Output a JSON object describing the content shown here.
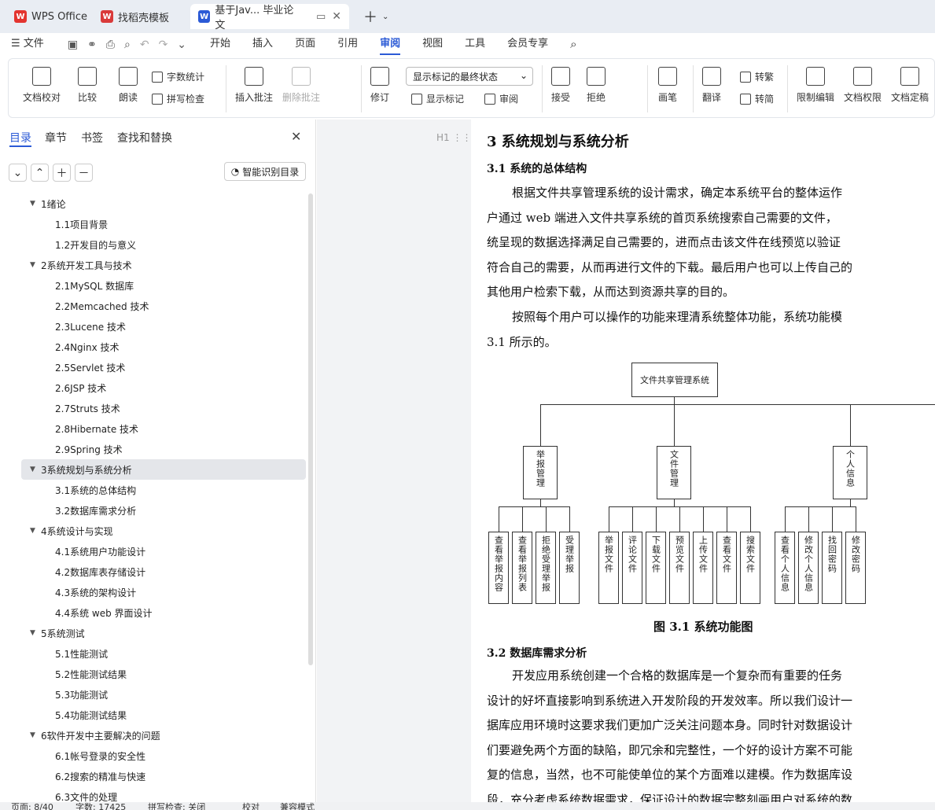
{
  "tabs": [
    {
      "label": "WPS Office"
    },
    {
      "label": "找稻壳模板"
    },
    {
      "label": "基于Jav... 毕业论文"
    }
  ],
  "menu": {
    "file": "文件",
    "items": [
      "开始",
      "插入",
      "页面",
      "引用",
      "审阅",
      "视图",
      "工具",
      "会员专享"
    ]
  },
  "ribbon": {
    "doc_check": "文档校对",
    "compare": "比较",
    "read": "朗读",
    "word_count": "字数统计",
    "spell_check": "拼写检查",
    "insert_comment": "插入批注",
    "delete_comment": "删除批注",
    "revise": "修订",
    "markup_state": "显示标记的最终状态",
    "show_markup": "显示标记",
    "review": "审阅",
    "accept": "接受",
    "reject": "拒绝",
    "pen": "画笔",
    "translate": "翻译",
    "to_traditional": "转繁",
    "to_simplified": "转简",
    "restrict_edit": "限制编辑",
    "doc_permission": "文档权限",
    "doc_finalize": "文档定稿"
  },
  "sidebar": {
    "tabs": [
      "目录",
      "章节",
      "书签",
      "查找和替换"
    ],
    "smart_toc": "智能识别目录",
    "toc": [
      {
        "label": "1绪论",
        "level": 1
      },
      {
        "label": "1.1项目背景",
        "level": 2
      },
      {
        "label": "1.2开发目的与意义",
        "level": 2
      },
      {
        "label": "2系统开发工具与技术",
        "level": 1
      },
      {
        "label": "2.1MySQL 数据库",
        "level": 2
      },
      {
        "label": "2.2Memcached 技术",
        "level": 2
      },
      {
        "label": "2.3Lucene 技术",
        "level": 2
      },
      {
        "label": "2.4Nginx 技术",
        "level": 2
      },
      {
        "label": "2.5Servlet 技术",
        "level": 2
      },
      {
        "label": "2.6JSP 技术",
        "level": 2
      },
      {
        "label": "2.7Struts 技术",
        "level": 2
      },
      {
        "label": "2.8Hibernate 技术",
        "level": 2
      },
      {
        "label": "2.9Spring 技术",
        "level": 2
      },
      {
        "label": "3系统规划与系统分析",
        "level": 1,
        "selected": true
      },
      {
        "label": "3.1系统的总体结构",
        "level": 2
      },
      {
        "label": "3.2数据库需求分析",
        "level": 2
      },
      {
        "label": "4系统设计与实现",
        "level": 1
      },
      {
        "label": "4.1系统用户功能设计",
        "level": 2
      },
      {
        "label": "4.2数据库表存储设计",
        "level": 2
      },
      {
        "label": "4.3系统的架构设计",
        "level": 2
      },
      {
        "label": "4.4系统 web 界面设计",
        "level": 2
      },
      {
        "label": "5系统测试",
        "level": 1
      },
      {
        "label": "5.1性能测试",
        "level": 2
      },
      {
        "label": "5.2性能测试结果",
        "level": 2
      },
      {
        "label": "5.3功能测试",
        "level": 2
      },
      {
        "label": "5.4功能测试结果",
        "level": 2
      },
      {
        "label": "6软件开发中主要解决的问题",
        "level": 1
      },
      {
        "label": "6.1帐号登录的安全性",
        "level": 2
      },
      {
        "label": "6.2搜索的精准与快速",
        "level": 2
      },
      {
        "label": "6.3文件的处理",
        "level": 2
      }
    ]
  },
  "document": {
    "heading_marker": "H1",
    "h1": "3 系统规划与系统分析",
    "h2a": "3.1  系统的总体结构",
    "p1": [
      "根据文件共享管理系统的设计需求，确定本系统平台的整体运作",
      "户通过 web 端进入文件共享系统的首页系统搜索自己需要的文件，",
      "统呈现的数据选择满足自己需要的，进而点击该文件在线预览以验证",
      "符合自己的需要，从而再进行文件的下载。最后用户也可以上传自己的",
      "其他用户检索下载，从而达到资源共享的目的。"
    ],
    "p2": [
      "按照每个用户可以操作的功能来理清系统整体功能，系统功能模",
      "3.1 所示的。"
    ],
    "diagram": {
      "root": "文件共享管理系统",
      "groups": [
        {
          "name": "举报管理",
          "leaves": [
            "查看举报内容",
            "查看举报列表",
            "拒绝受理举报",
            "受理举报"
          ]
        },
        {
          "name": "文件管理",
          "leaves": [
            "举报文件",
            "评论文件",
            "下载文件",
            "预览文件",
            "上传文件",
            "查看文件",
            "搜索文件"
          ]
        },
        {
          "name": "个人信息",
          "leaves": [
            "查看个人信息",
            "修改个人信息",
            "找回密码",
            "修改密码"
          ]
        }
      ]
    },
    "caption": "图 3.1  系统功能图",
    "h2b": "3.2  数据库需求分析",
    "p3": [
      "开发应用系统创建一个合格的数据库是一个复杂而有重要的任务",
      "设计的好坏直接影响到系统进入开发阶段的开发效率。所以我们设计一",
      "据库应用环境时这要求我们更加广泛关注问题本身。同时针对数据设计",
      "们要避免两个方面的缺陷，即冗余和完整性，一个好的设计方案不可能",
      "复的信息，当然，也不可能使单位的某个方面难以建模。作为数据库设",
      "段，充分考虑系统数据需求，保证设计的数据完整刻画用户对系统的数"
    ]
  },
  "status": {
    "page": "页面: 8/40",
    "words": "字数: 17425",
    "spell": "拼写检查: 关闭",
    "proof": "校对",
    "compat": "兼容模式"
  }
}
